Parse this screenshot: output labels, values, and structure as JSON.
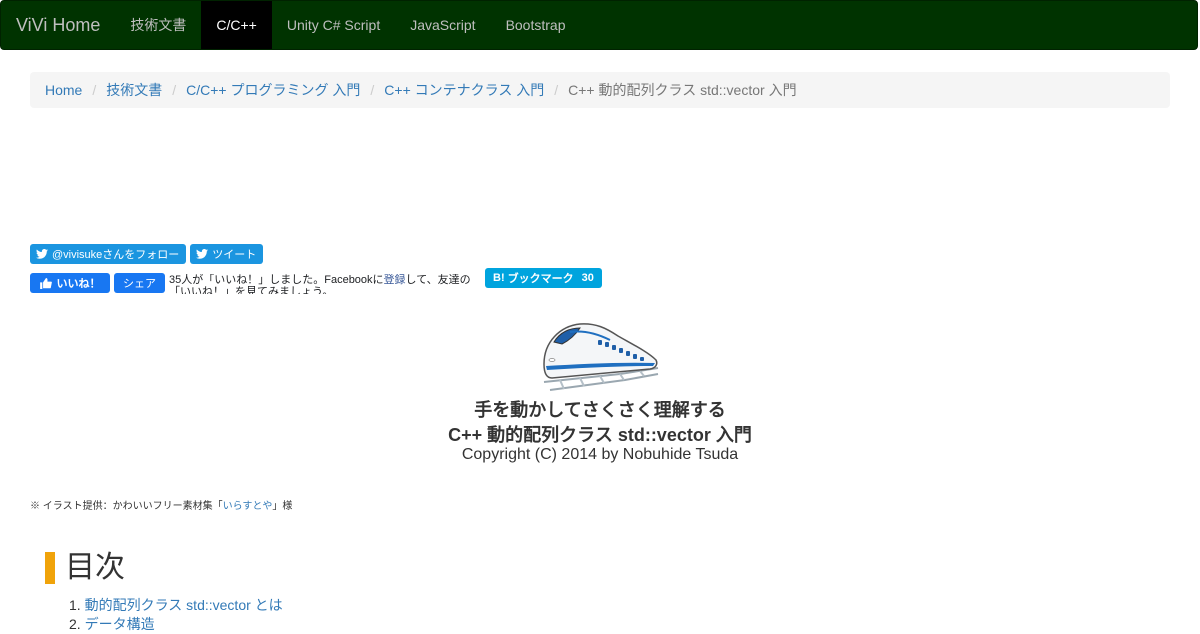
{
  "navbar": {
    "brand": "ViVi Home",
    "items": [
      {
        "label": "技術文書",
        "active": false
      },
      {
        "label": "C/C++",
        "active": true
      },
      {
        "label": "Unity C# Script",
        "active": false
      },
      {
        "label": "JavaScript",
        "active": false
      },
      {
        "label": "Bootstrap",
        "active": false
      }
    ],
    "bg_color": "#003300"
  },
  "breadcrumb": {
    "items": [
      {
        "label": "Home"
      },
      {
        "label": "技術文書"
      },
      {
        "label": "C/C++ プログラミング 入門"
      },
      {
        "label": "C++ コンテナクラス 入門"
      }
    ],
    "current": "C++ 動的配列クラス std::vector 入門",
    "separator": "/"
  },
  "social": {
    "twitter_follow": "@vivisukeさんをフォロー",
    "twitter_tweet": "ツイート",
    "fb_like": "いいね！",
    "fb_share": "シェア",
    "fb_text_before": "35人が「いいね！」しました。Facebookに",
    "fb_text_link": "登録",
    "fb_text_after": "して、友達の「いいね！」を見てみましょう。",
    "hatena_label": "ブックマーク",
    "hatena_count": "30"
  },
  "hero": {
    "image_icon": "shinkansen-train-illustration",
    "title_line1": "手を動かしてさくさく理解する",
    "title_line2": "C++ 動的配列クラス std::vector 入門",
    "copyright": "Copyright (C) 2014 by Nobuhide Tsuda"
  },
  "credit": {
    "prefix": "※ イラスト提供：かわいいフリー素材集「",
    "link": "いらすとや",
    "suffix": "」様"
  },
  "toc": {
    "heading": "目次",
    "items": [
      {
        "num": "1.",
        "label": "動的配列クラス std::vector とは"
      },
      {
        "num": "2.",
        "label": "データ構造"
      }
    ]
  }
}
